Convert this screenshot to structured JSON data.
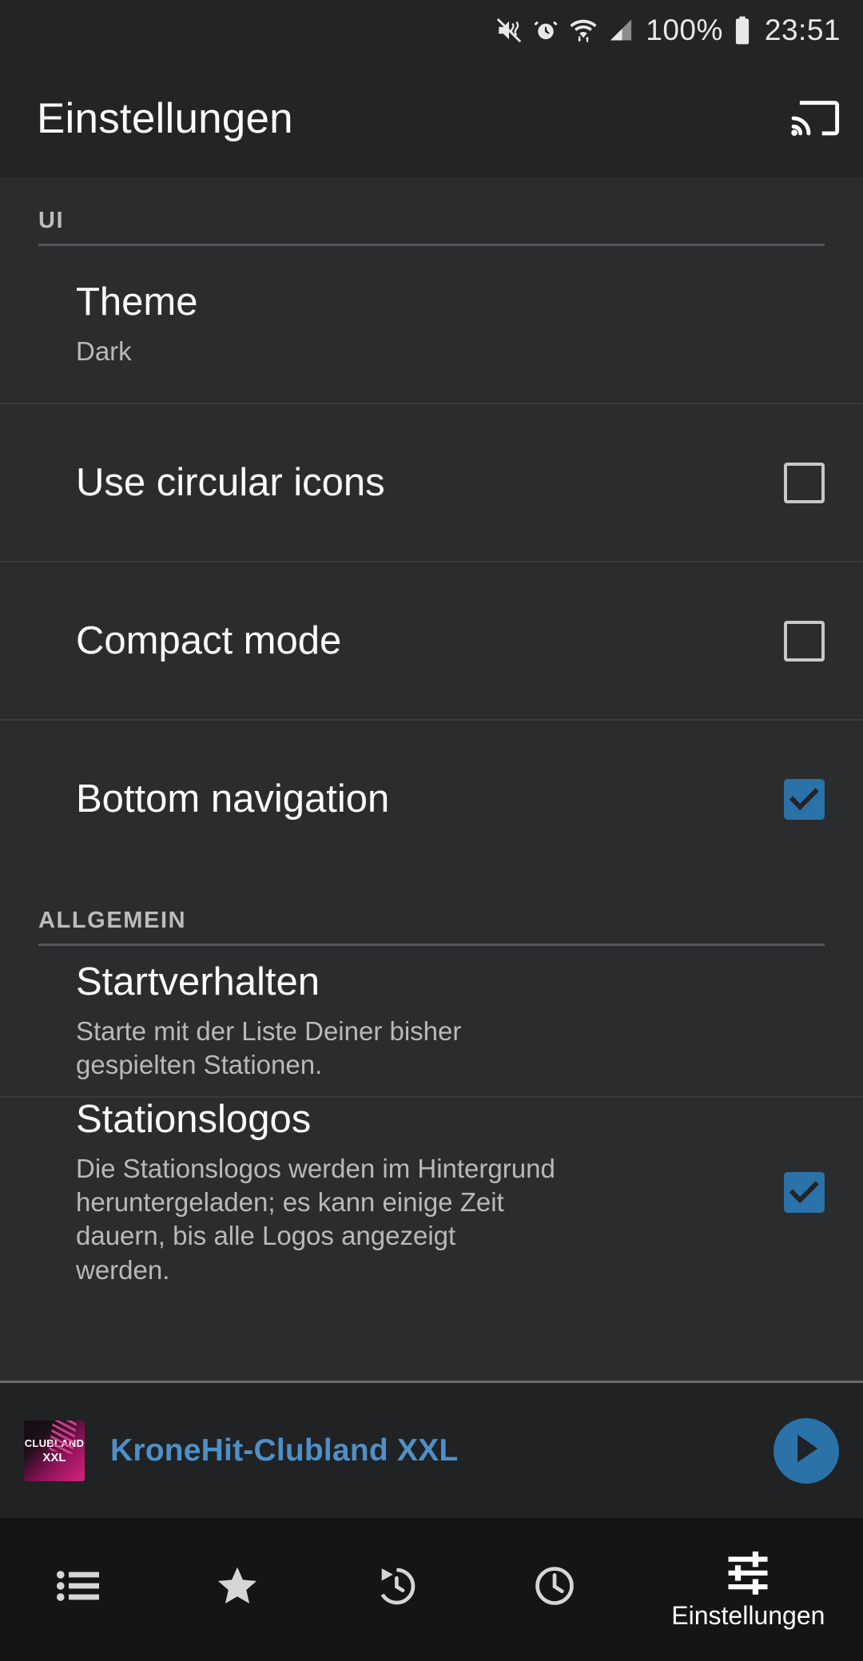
{
  "status_bar": {
    "icons": [
      "mute-vibrate-icon",
      "alarm-icon",
      "wifi-icon",
      "cellular-signal-icon"
    ],
    "battery_percent": "100%",
    "battery_icon": "battery-full-icon",
    "time": "23:51"
  },
  "app_bar": {
    "title": "Einstellungen",
    "cast_icon": "cast-icon"
  },
  "colors": {
    "accent": "#2a72a8",
    "background": "#2b2c2e",
    "chrome": "#232426",
    "nav_background": "#141516",
    "title_text": "#ffffff",
    "secondary_text": "#b9b9b9",
    "now_playing_title": "#4e90c7"
  },
  "sections": [
    {
      "header": "UI",
      "rows": [
        {
          "title": "Theme",
          "subtitle": "Dark",
          "control": "none",
          "checked": null
        },
        {
          "title": "Use circular icons",
          "subtitle": "",
          "control": "checkbox",
          "checked": false
        },
        {
          "title": "Compact mode",
          "subtitle": "",
          "control": "checkbox",
          "checked": false
        },
        {
          "title": "Bottom navigation",
          "subtitle": "",
          "control": "checkbox",
          "checked": true
        }
      ]
    },
    {
      "header": "ALLGEMEIN",
      "rows": [
        {
          "title": "Startverhalten",
          "subtitle": "Starte mit der Liste Deiner bisher gespielten Stationen.",
          "control": "none",
          "checked": null
        },
        {
          "title": "Stationslogos",
          "subtitle": "Die Stationslogos werden im Hintergrund heruntergeladen; es kann einige Zeit dauern, bis alle Logos angezeigt werden.",
          "control": "checkbox",
          "checked": true
        }
      ]
    }
  ],
  "now_playing": {
    "station": "KroneHit-Clubland XXL",
    "logo_line1": "CLUBLAND",
    "logo_line2": "XXL",
    "logo_icon": "station-logo",
    "play_icon": "play-icon"
  },
  "bottom_nav": [
    {
      "icon": "list-icon",
      "label": "",
      "active": false
    },
    {
      "icon": "star-icon",
      "label": "",
      "active": false
    },
    {
      "icon": "history-icon",
      "label": "",
      "active": false
    },
    {
      "icon": "clock-icon",
      "label": "",
      "active": false
    },
    {
      "icon": "tuner-icon",
      "label": "Einstellungen",
      "active": true
    }
  ]
}
